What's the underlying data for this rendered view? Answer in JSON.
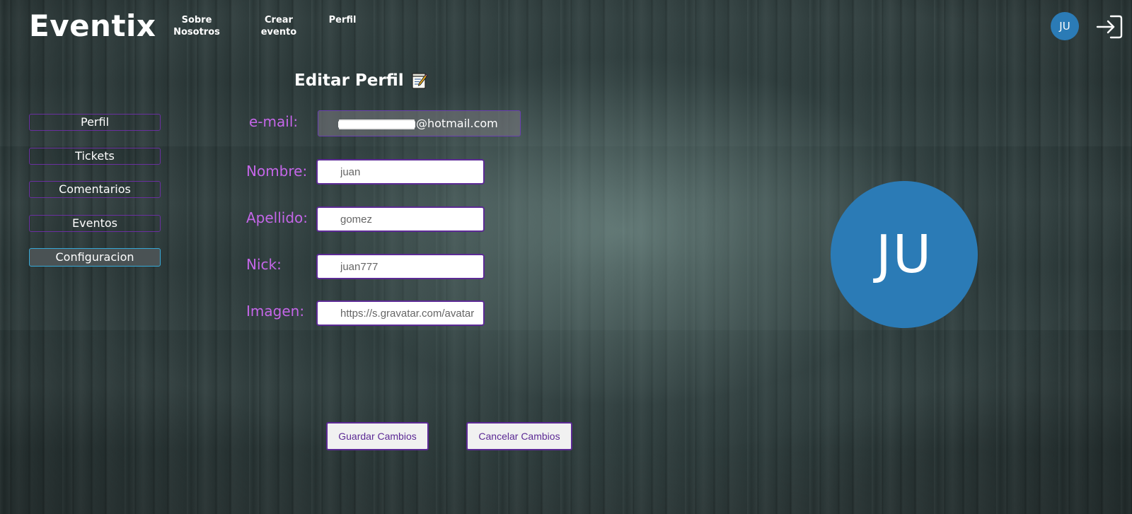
{
  "header": {
    "brand": "Eventix",
    "nav": {
      "sobre_line1": "Sobre",
      "sobre_line2": "Nosotros",
      "crear_line1": "Crear",
      "crear_line2": "evento",
      "perfil": "Perfil"
    },
    "avatar_initials": "JU",
    "logout_icon": "logout-icon"
  },
  "sidebar": {
    "items": [
      {
        "label": "Perfil"
      },
      {
        "label": "Tickets"
      },
      {
        "label": "Comentarios"
      },
      {
        "label": "Eventos"
      },
      {
        "label": "Configuracion"
      }
    ],
    "active": "Configuracion"
  },
  "form": {
    "title": "Editar Perfil",
    "title_icon": "memo-icon",
    "labels": {
      "email": "e-mail:",
      "nombre": "Nombre:",
      "apellido": "Apellido:",
      "nick": "Nick:",
      "imagen": "Imagen:"
    },
    "email_visible_suffix": "@hotmail.com",
    "values": {
      "nombre": "juan",
      "apellido": "gomez",
      "nick": "juan777",
      "imagen": "https://s.gravatar.com/avatar"
    },
    "buttons": {
      "save": "Guardar Cambios",
      "cancel": "Cancelar Cambios"
    }
  },
  "profile_avatar": {
    "initials": "JU"
  },
  "colors": {
    "accent_purple": "#5c2a95",
    "label_purple": "#c466e8",
    "avatar_blue": "#2b7bb6",
    "active_border": "#37a9d8"
  }
}
